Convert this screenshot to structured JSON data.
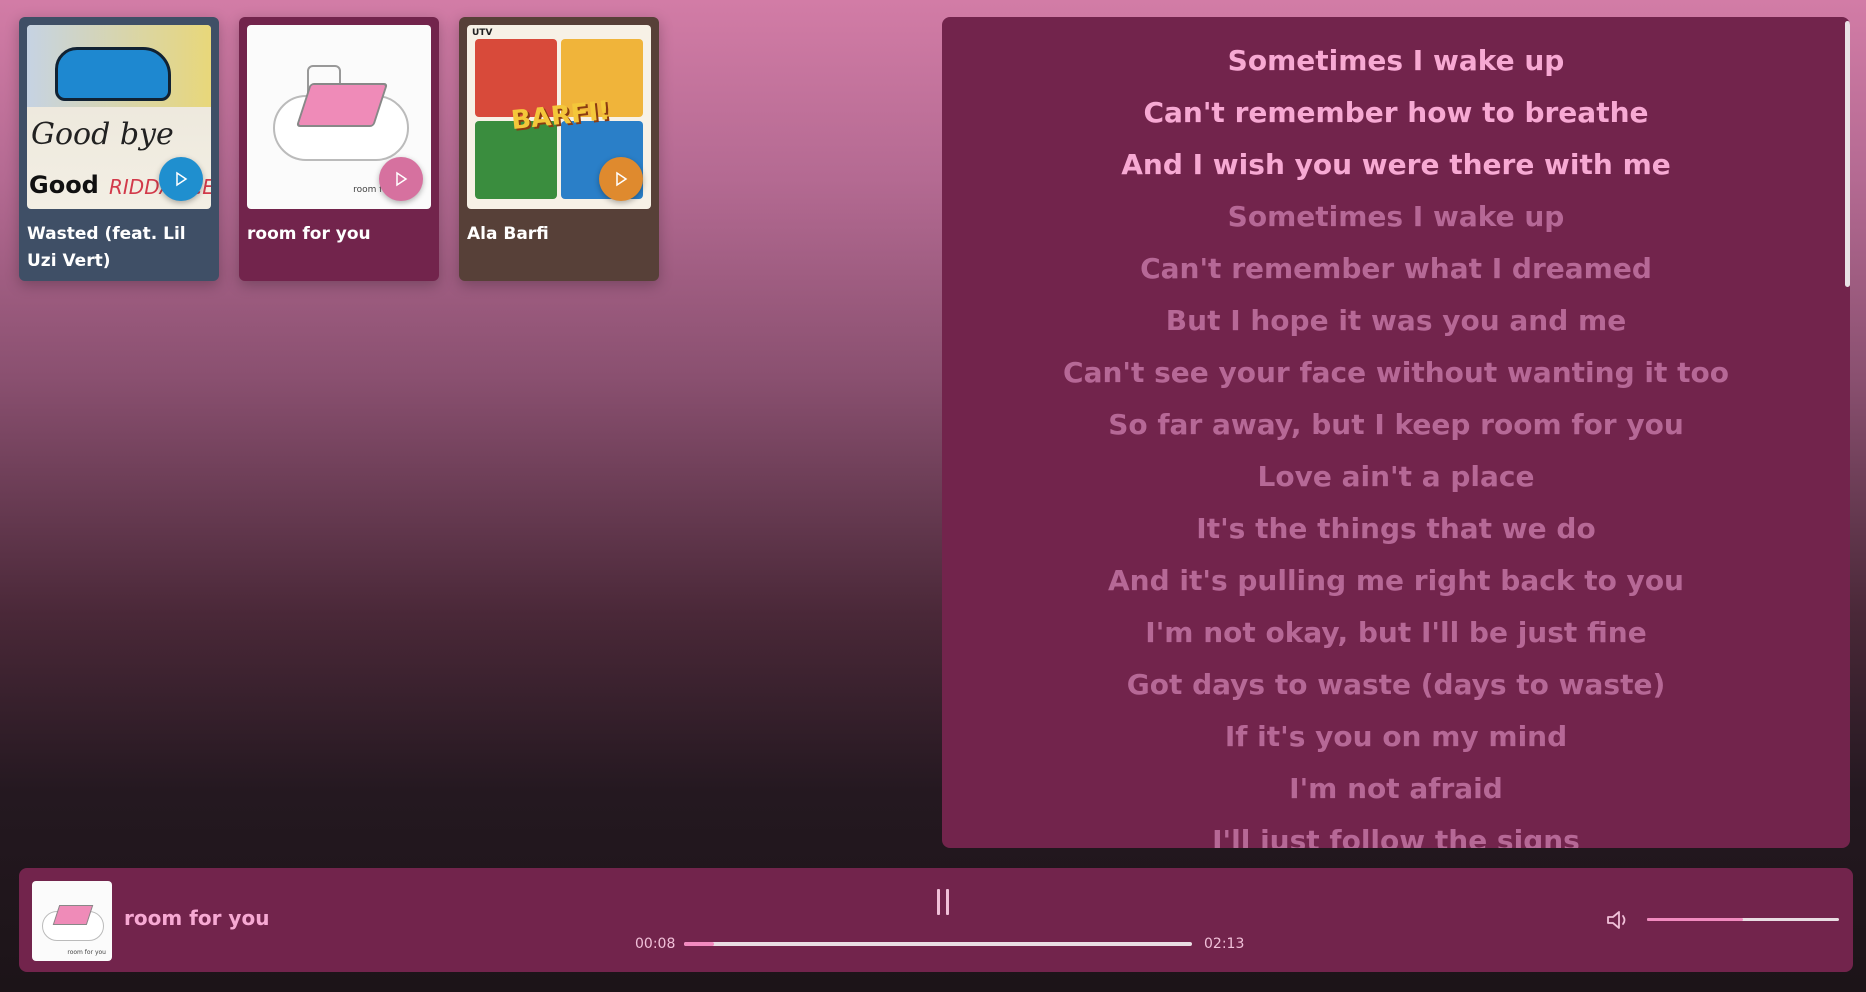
{
  "cards": [
    {
      "title": "Wasted (feat. Lil Uzi Vert)",
      "bg": "#3f4f66",
      "play_color": "#1f8fcf",
      "art_text": [
        "Good bye",
        "&",
        "Good",
        "RIDDANCE"
      ]
    },
    {
      "title": "room for you",
      "bg": "#72244c",
      "play_color": "#d6719f",
      "art_text": [
        "room for you"
      ]
    },
    {
      "title": "Ala Barfi",
      "bg": "#574038",
      "play_color": "#df8a2e",
      "art_text": [
        "UTV",
        "BARFI!"
      ]
    }
  ],
  "lyrics": [
    {
      "text": "Sometimes I wake up",
      "active": true
    },
    {
      "text": "Can't remember how to breathe",
      "active": true
    },
    {
      "text": "And I wish you were there with me",
      "active": true
    },
    {
      "text": "Sometimes I wake up",
      "active": false
    },
    {
      "text": "Can't remember what I dreamed",
      "active": false
    },
    {
      "text": "But I hope it was you and me",
      "active": false
    },
    {
      "text": "Can't see your face without wanting it too",
      "active": false
    },
    {
      "text": "So far away, but I keep room for you",
      "active": false
    },
    {
      "text": "Love ain't a place",
      "active": false
    },
    {
      "text": "It's the things that we do",
      "active": false
    },
    {
      "text": "And it's pulling me right back to you",
      "active": false
    },
    {
      "text": "I'm not okay, but I'll be just fine",
      "active": false
    },
    {
      "text": "Got days to waste (days to waste)",
      "active": false
    },
    {
      "text": "If it's you on my mind",
      "active": false
    },
    {
      "text": "I'm not afraid",
      "active": false
    },
    {
      "text": "I'll just follow the signs",
      "active": false
    }
  ],
  "player": {
    "title": "room for you",
    "thumb_text": "room for you",
    "current_time": "00:08",
    "total_time": "02:13",
    "progress": 0.06,
    "volume": 0.5,
    "state_icon": "pause-icon",
    "volume_icon": "volume-icon"
  },
  "colors": {
    "accent": "#f7a9d3",
    "panel": "#72244c",
    "progress_fill": "#f28abf"
  }
}
